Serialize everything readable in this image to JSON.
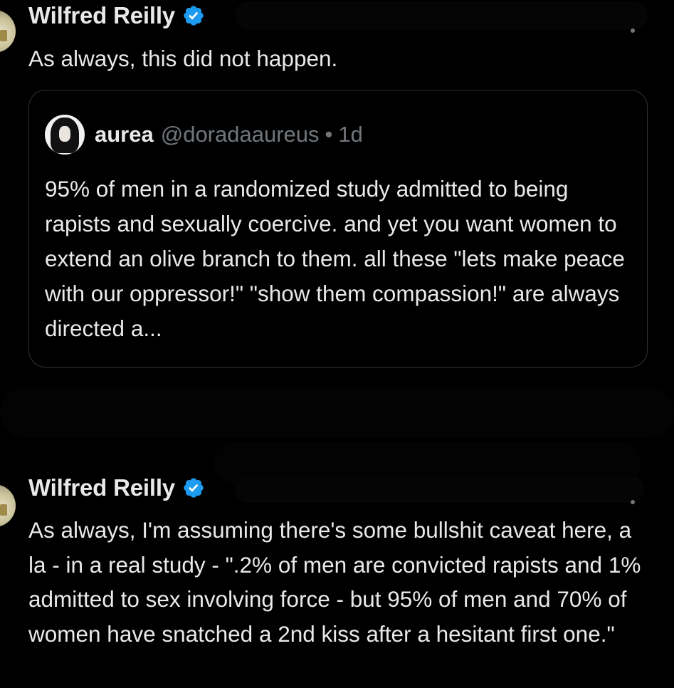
{
  "tweets": [
    {
      "author": "Wilfred Reilly",
      "text": "As always, this did not happen.",
      "quote": {
        "name": "aurea",
        "handle": "@doradaaureus",
        "separator": "•",
        "time": "1d",
        "text": "95% of men in a randomized study admitted to being rapists and sexually coercive. and yet you want women to extend an olive branch to them. all these \"lets make peace with our oppressor!\" \"show them compassion!\" are always directed a..."
      }
    },
    {
      "author": "Wilfred Reilly",
      "text": "As always, I'm assuming there's some bullshit caveat here, a la - in a real study - \".2% of men are convicted rapists and 1% admitted to sex involving force - but 95% of men and 70% of women have snatched a 2nd kiss after a hesitant first one.\""
    }
  ],
  "icons": {
    "verified": "verified-badge-icon",
    "avatar": "profile-avatar"
  },
  "colors": {
    "background": "#000000",
    "text_primary": "#e7e9ea",
    "text_secondary": "#71767b",
    "border": "#2f3336",
    "verified_blue": "#1d9bf0"
  }
}
